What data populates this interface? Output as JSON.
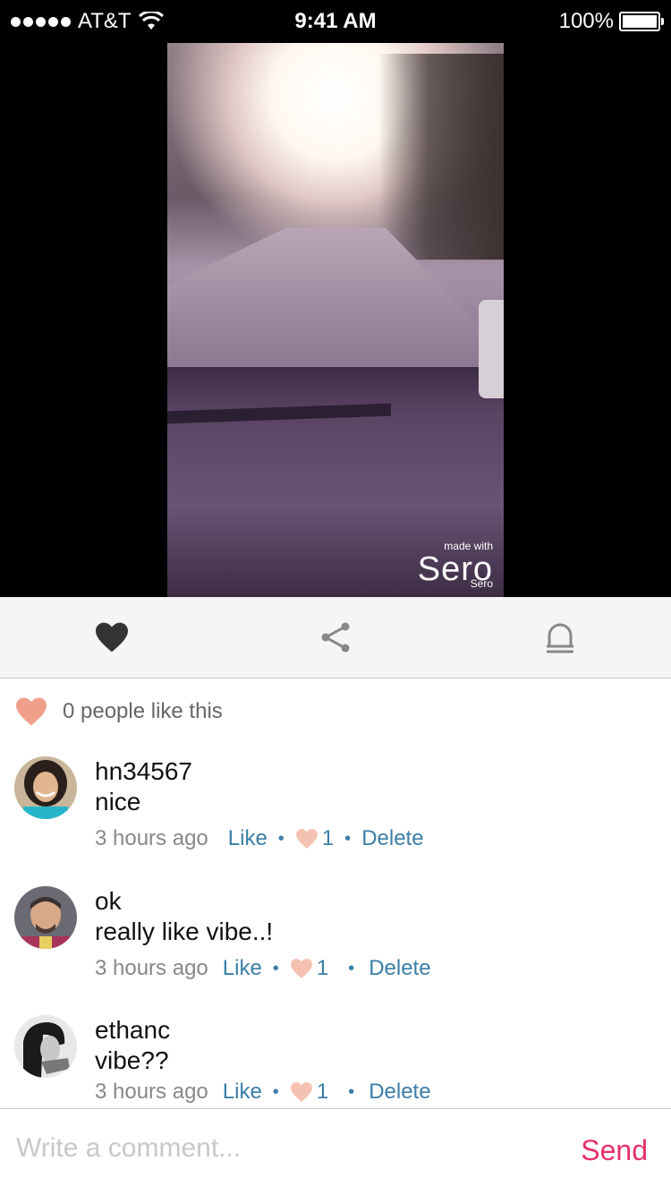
{
  "status_bar": {
    "carrier": "AT&T",
    "time": "9:41 AM",
    "battery": "100%"
  },
  "video": {
    "watermark_made": "made with",
    "watermark_logo": "Sero",
    "watermark_small": "Sero"
  },
  "actions": [
    "heart-icon",
    "share-icon",
    "report-icon"
  ],
  "likes": {
    "text": "0 people like this",
    "color": "#f0a08a"
  },
  "comments": [
    {
      "user": "hn34567",
      "text": "nice",
      "time": "3 hours ago",
      "like": "Like",
      "count": "1",
      "delete": "Delete"
    },
    {
      "user": "ok",
      "text": "really like vibe..!",
      "time": "3 hours ago",
      "like": "Like",
      "count": "1",
      "delete": "Delete"
    },
    {
      "user": "ethanc",
      "text": "vibe??",
      "time": "3 hours ago",
      "like": "Like",
      "count": "1",
      "delete": "Delete"
    }
  ],
  "compose": {
    "placeholder": "Write a comment...",
    "send": "Send"
  },
  "colors": {
    "accent": "#e8306a",
    "link": "#3a7ea8",
    "heart": "#f0a08a"
  }
}
